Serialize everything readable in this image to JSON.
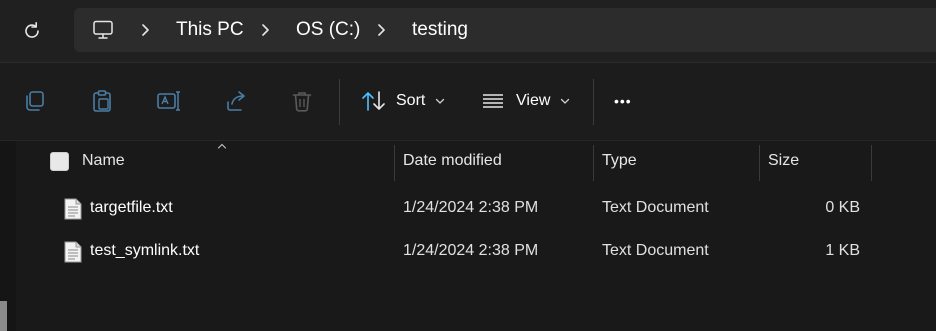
{
  "breadcrumb": {
    "items": [
      "This PC",
      "OS (C:)",
      "testing"
    ]
  },
  "toolbar": {
    "sort_label": "Sort",
    "view_label": "View",
    "more_label": "•••"
  },
  "columns": {
    "name": "Name",
    "date": "Date modified",
    "type": "Type",
    "size": "Size"
  },
  "files": [
    {
      "name": "targetfile.txt",
      "date": "1/24/2024 2:38 PM",
      "type": "Text Document",
      "size": "0 KB"
    },
    {
      "name": "test_symlink.txt",
      "date": "1/24/2024 2:38 PM",
      "type": "Text Document",
      "size": "1 KB"
    }
  ],
  "colors": {
    "accent": "#4cc2ff",
    "background": "#191919",
    "disabled_icon": "#4a7ea5"
  },
  "icons": {
    "refresh": "refresh-icon",
    "computer": "computer-icon",
    "copy": "copy-icon",
    "paste": "paste-icon",
    "rename": "rename-icon",
    "share": "share-icon",
    "delete": "delete-icon",
    "sort": "sort-icon",
    "view": "view-icon",
    "file": "text-file-icon"
  }
}
